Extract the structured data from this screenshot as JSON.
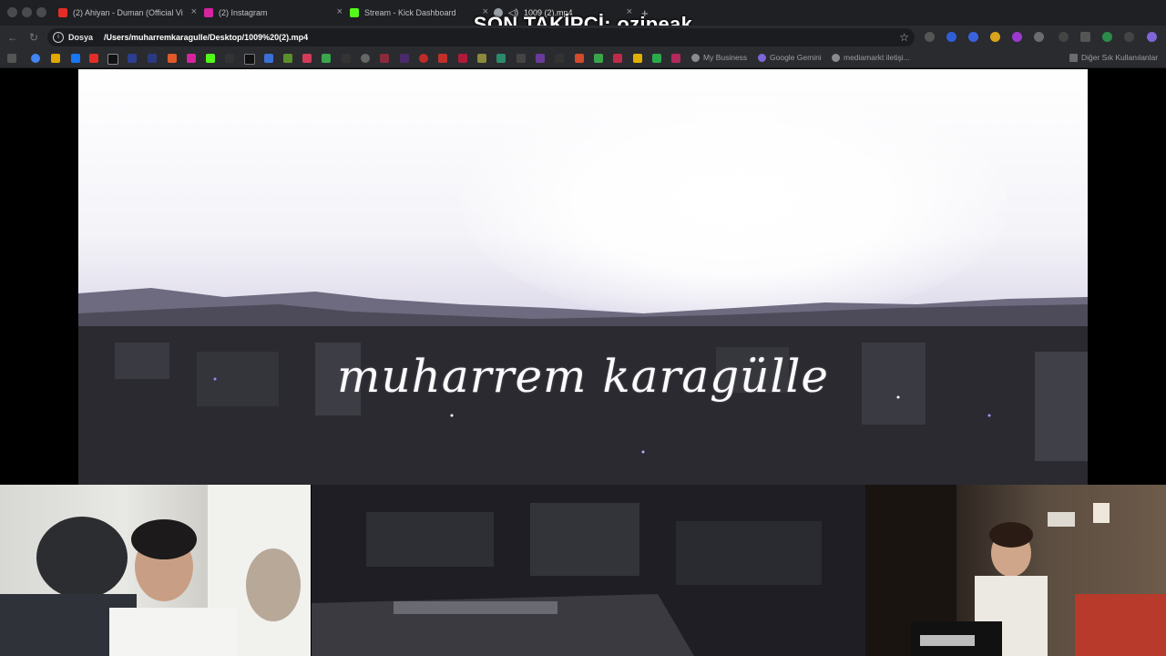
{
  "browser": {
    "tabs": [
      {
        "label": "(2) Ahiyan - Duman (Official Vi",
        "icon": "youtube-icon",
        "color": "#e52d27"
      },
      {
        "label": "(2) Instagram",
        "icon": "instagram-icon",
        "color": "#d6249f"
      },
      {
        "label": "Stream - Kick Dashboard",
        "icon": "kick-icon",
        "color": "#53fc18"
      },
      {
        "label": "1009 (2).mp4",
        "icon": "globe-icon",
        "color": "#9aa0a6"
      }
    ],
    "new_tab": "+",
    "address": {
      "scheme": "Dosya",
      "url": "/Users/muharremkaragulle/Desktop/1009%20(2).mp4"
    },
    "bookmarks": {
      "named": [
        "My Business",
        "Google Gemini",
        "mediamarkt iletişi..."
      ],
      "other": "Diğer Sık Kullanılanlar"
    }
  },
  "overlay": {
    "follower": "SON TAKİPÇİ: ozipeak"
  },
  "video": {
    "signature": "muharrem karagülle"
  }
}
